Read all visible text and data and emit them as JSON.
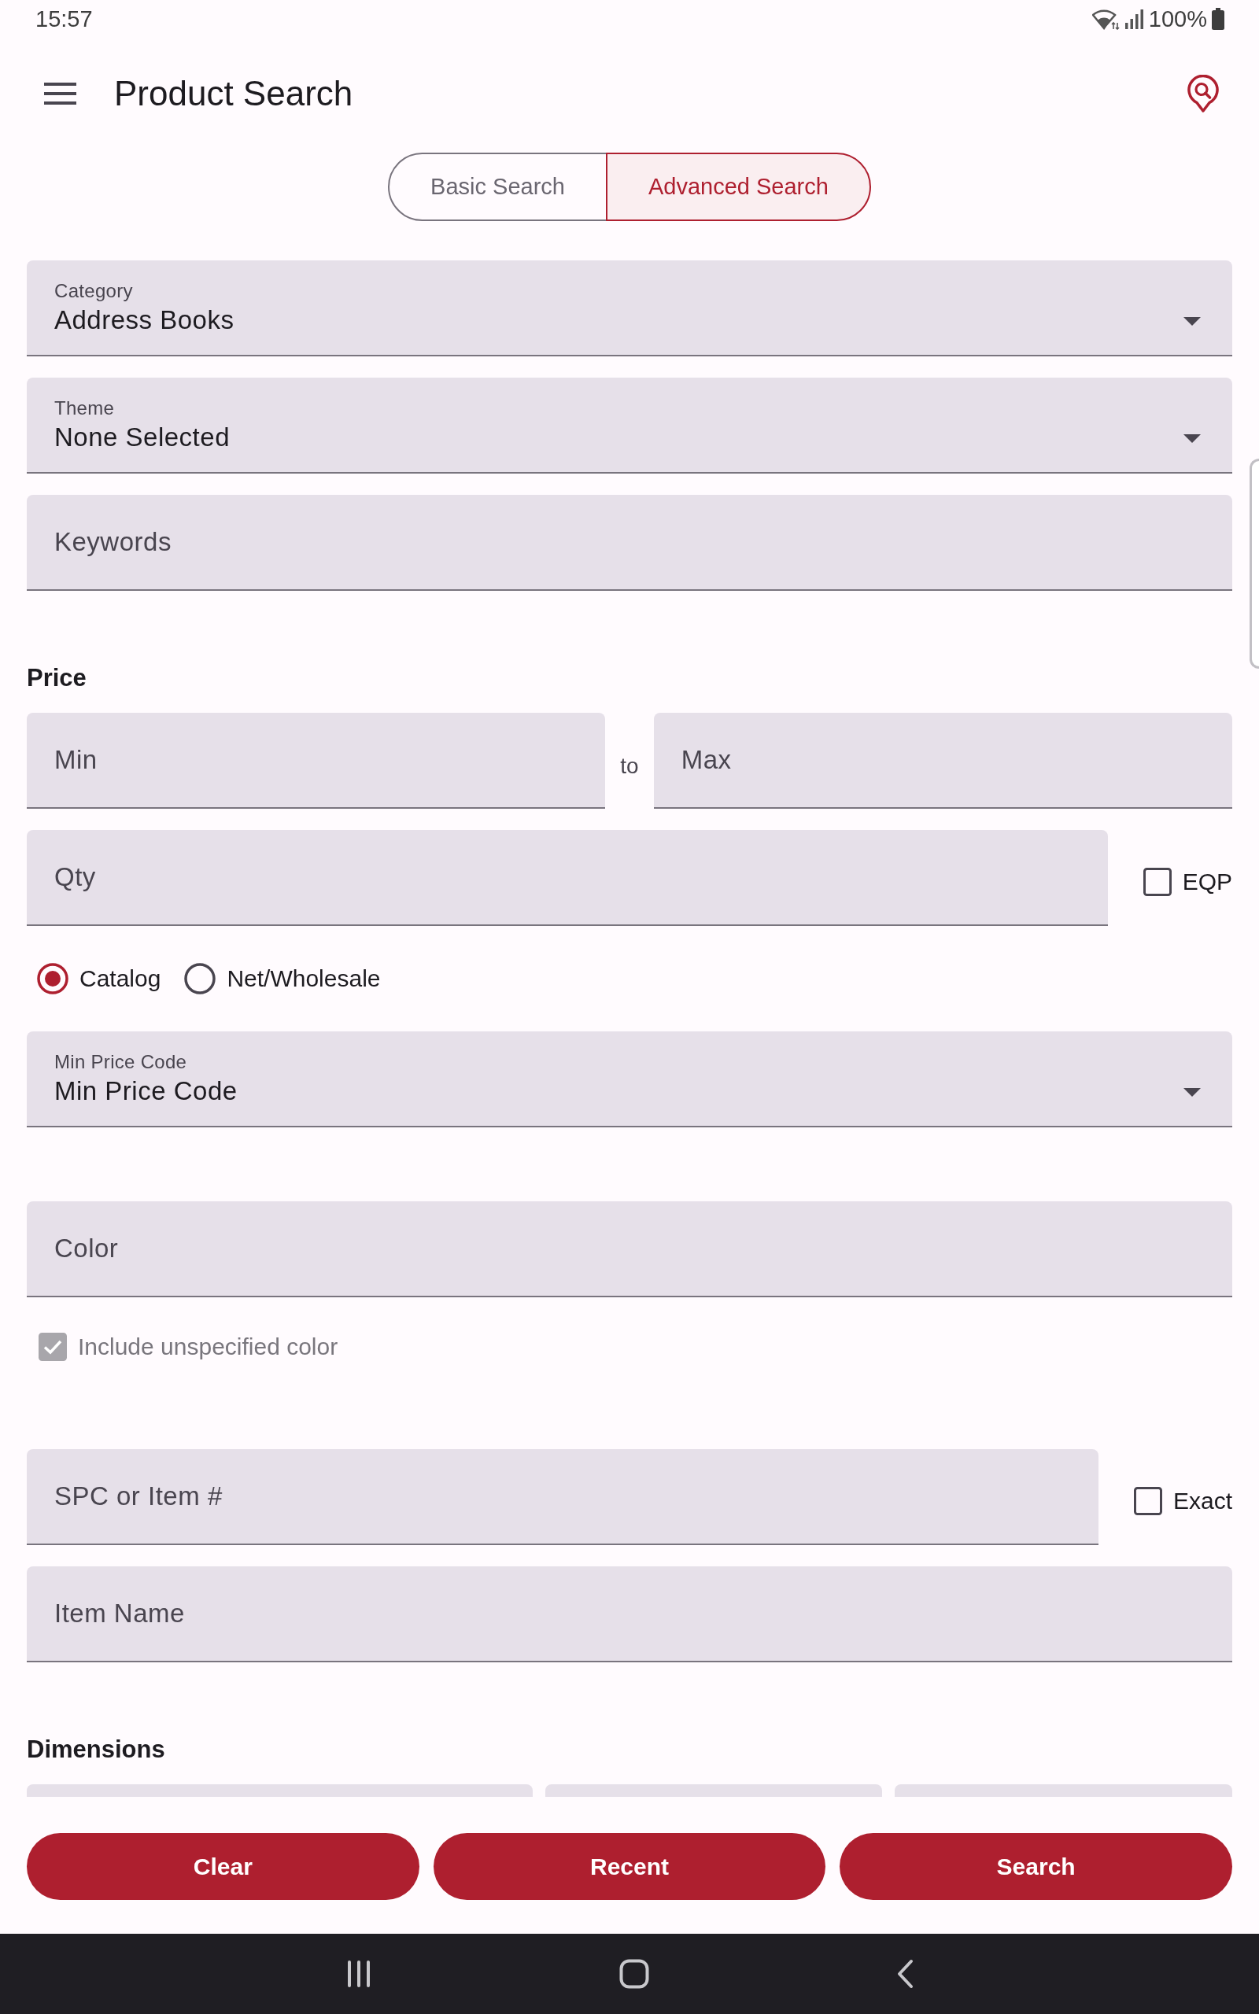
{
  "status_bar": {
    "time": "15:57",
    "battery": "100%"
  },
  "app_bar": {
    "title": "Product Search"
  },
  "tabs": [
    {
      "label": "Basic Search",
      "selected": false
    },
    {
      "label": "Advanced Search",
      "selected": true
    }
  ],
  "sections": [
    {
      "rows": [
        {
          "kind": "select",
          "label": "Category",
          "value": "Address Books"
        },
        {
          "kind": "select",
          "label": "Theme",
          "value": "None Selected"
        },
        {
          "kind": "text",
          "placeholder": "Keywords"
        }
      ]
    },
    {
      "heading": "Price",
      "rows": [
        {
          "kind": "range",
          "min": {
            "placeholder": "Min"
          },
          "separator": "to",
          "max": {
            "placeholder": "Max"
          }
        },
        {
          "kind": "text_check",
          "placeholder": "Qty",
          "check": {
            "label": "EQP",
            "checked": false,
            "disabled": false
          }
        },
        {
          "kind": "radios",
          "options": [
            {
              "label": "Catalog",
              "selected": true
            },
            {
              "label": "Net/Wholesale",
              "selected": false
            }
          ]
        },
        {
          "kind": "select",
          "label": "Min Price Code",
          "value": "Min Price Code"
        }
      ]
    },
    {
      "rows": [
        {
          "kind": "text",
          "placeholder": "Color"
        },
        {
          "kind": "check",
          "label": "Include unspecified color",
          "checked": true,
          "disabled": true
        }
      ]
    },
    {
      "rows": [
        {
          "kind": "text_check",
          "placeholder": "SPC or Item #",
          "check": {
            "label": "Exact",
            "checked": false,
            "disabled": false
          }
        },
        {
          "kind": "text",
          "placeholder": "Item Name"
        }
      ]
    },
    {
      "heading": "Dimensions",
      "rows": [
        {
          "kind": "partial_fields",
          "fields": [
            {
              "kind": "wide"
            },
            {
              "kind": "narrow"
            },
            {
              "kind": "narrow"
            }
          ]
        }
      ]
    }
  ],
  "actions": [
    "Clear",
    "Recent",
    "Search"
  ]
}
